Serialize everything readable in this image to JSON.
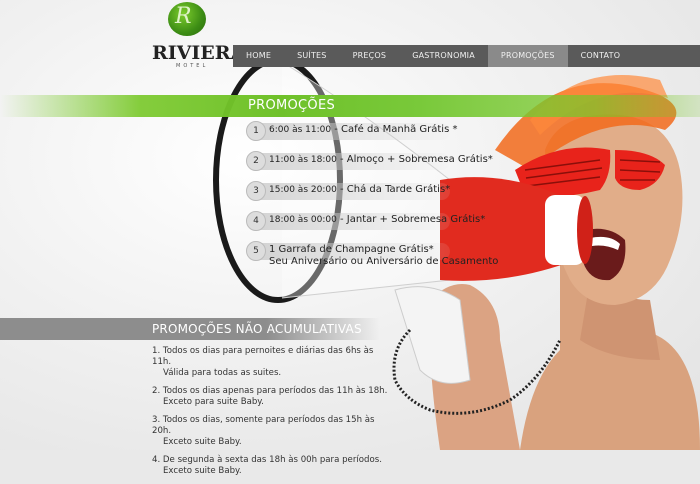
{
  "logo": {
    "wordmark": "RIVIERAS",
    "sub": "MOTEL",
    "glyph": "R"
  },
  "nav": [
    "HOME",
    "SUÍTES",
    "PREÇOS",
    "GASTRONOMIA",
    "PROMOÇÕES",
    "CONTATO"
  ],
  "active_nav": "PROMOÇÕES",
  "promotions": {
    "title": "PROMOÇÕES",
    "items": [
      {
        "num": "1",
        "time": "6:00 às 11:00",
        "sep": " - ",
        "text": "Café da Manhã Grátis *"
      },
      {
        "num": "2",
        "time": "11:00 às 18:00",
        "sep": " - ",
        "text": "Almoço + Sobremesa Grátis*"
      },
      {
        "num": "3",
        "time": "15:00 às 20:00",
        "sep": " - ",
        "text": "Chá da Tarde Grátis*"
      },
      {
        "num": "4",
        "time": "18:00 às 00:00",
        "sep": " - ",
        "text": "Jantar + Sobremesa Grátis*"
      },
      {
        "num": "5",
        "text": "1 Garrafa de Champagne Grátis*",
        "sub": "Seu Aniversário ou Aniversário de Casamento"
      }
    ]
  },
  "non_cumulative": {
    "title": "PROMOÇÕES NÃO ACUMULATIVAS",
    "items": [
      {
        "line1": "1. Todos os dias para pernoites e diárias das 6hs às 11h.",
        "line2": "Válida para todas as suites."
      },
      {
        "line1": "2. Todos os dias apenas para períodos das 11h às 18h.",
        "line2": "Exceto para suite Baby."
      },
      {
        "line1": "3. Todos os dias, somente para períodos das 15h às 20h.",
        "line2": "Exceto suite Baby."
      },
      {
        "line1": "4. De segunda à sexta das 18h às 00h para períodos.",
        "line2": "Exceto suite Baby."
      }
    ]
  },
  "colors": {
    "green": "#6fc12a",
    "nav_bg": "#5a5a5a",
    "nav_active": "#8a8a8a",
    "megaphone_red": "#d9261c",
    "visor_orange": "#f26a1b"
  }
}
